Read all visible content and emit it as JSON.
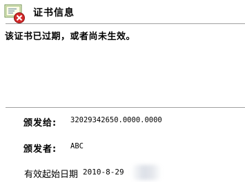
{
  "header": {
    "title": "证书信息",
    "icon": "certificate-error-icon"
  },
  "warning": "该证书已过期，或者尚未生效。",
  "issued_to": {
    "label": "颁发给:",
    "value": "32029342650.0000.0000"
  },
  "issued_by": {
    "label": "颁发者:",
    "value": "ABC"
  },
  "valid_from": {
    "label": "有效起始日期",
    "value": "2010-8-29"
  }
}
